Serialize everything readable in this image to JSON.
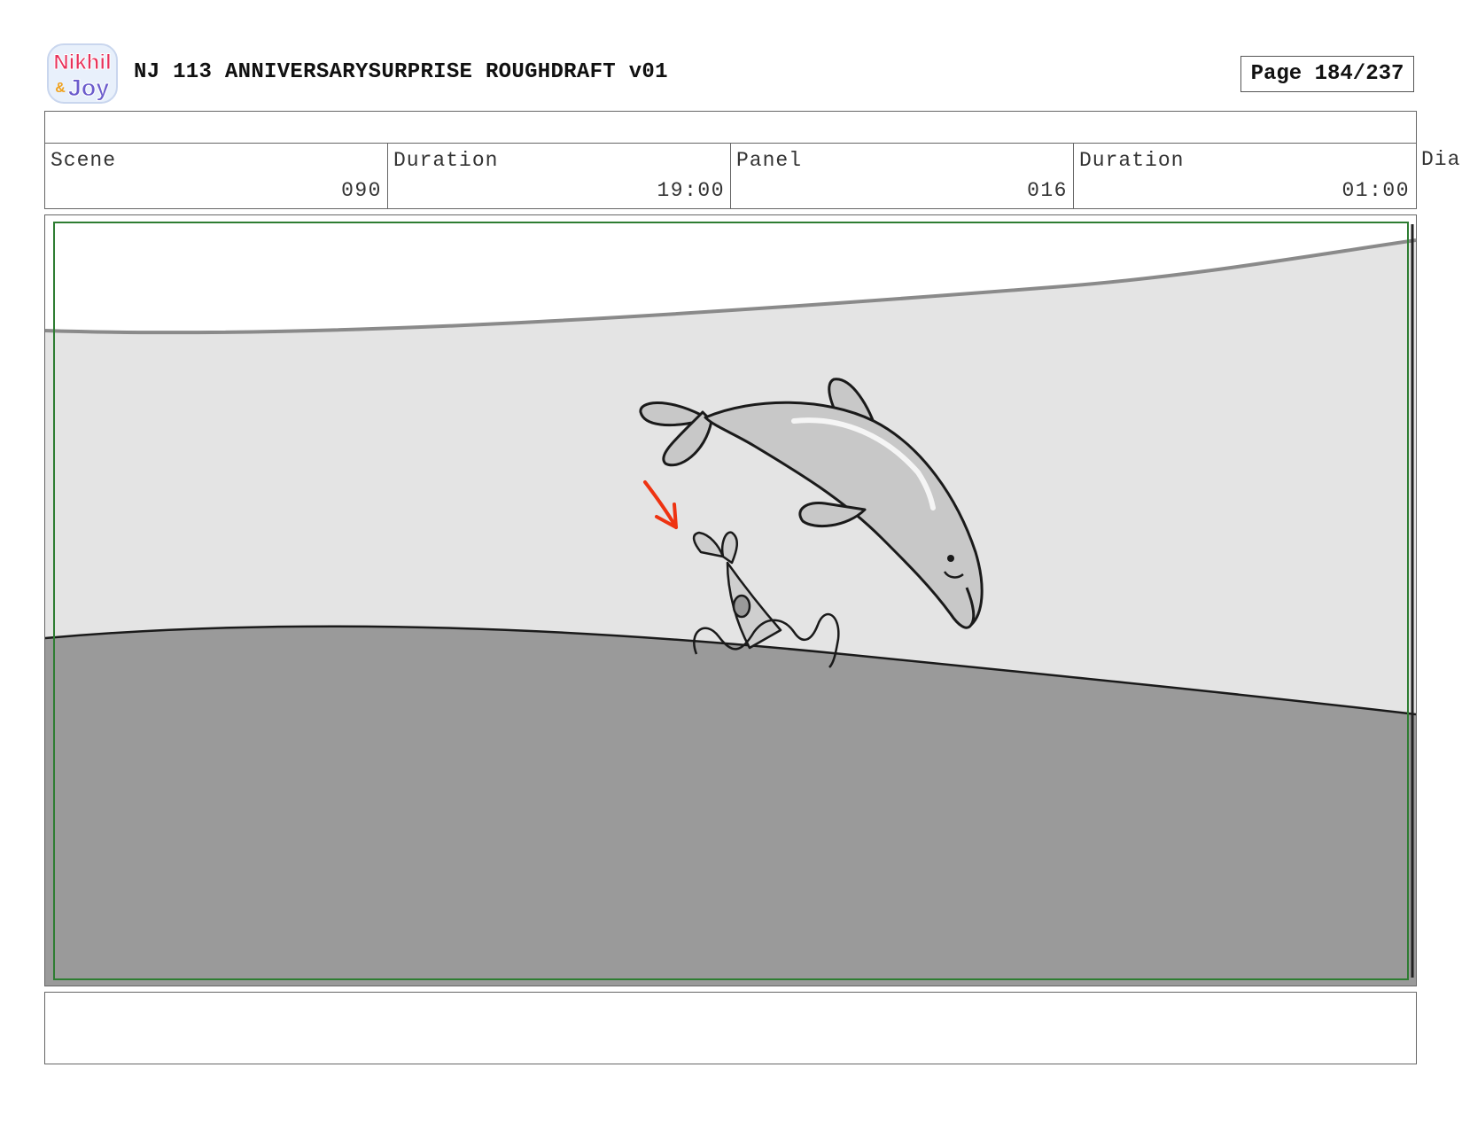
{
  "header": {
    "logo": {
      "icon": "nikhil-and-joy-logo",
      "text_line1": "Nikhil",
      "text_line2": "Joy",
      "ampersand": "&"
    },
    "title": "NJ 113 ANNIVERSARYSURPRISE ROUGHDRAFT v01",
    "page_label": "Page 184/237"
  },
  "meta": {
    "scene_label": "Scene",
    "scene_value": "090",
    "scene_duration_label": "Duration",
    "scene_duration_value": "19:00",
    "panel_label": "Panel",
    "panel_value": "016",
    "panel_duration_label": "Duration",
    "panel_duration_value": "01:00",
    "dialogue_label_clipped": "Dia"
  },
  "panel": {
    "icons": [
      "large-dolphin-icon",
      "small-dolphin-icon",
      "red-arrow-icon",
      "water-splash-icon"
    ],
    "colors": {
      "sky_top": "#ffffff",
      "sky_band": "#e4e4e4",
      "water": "#9a9a9a",
      "dolphin": "#c8c8c8",
      "arrow": "#ee3311",
      "safe_frame": "#2e7d32"
    }
  },
  "notes": {
    "text": ""
  }
}
